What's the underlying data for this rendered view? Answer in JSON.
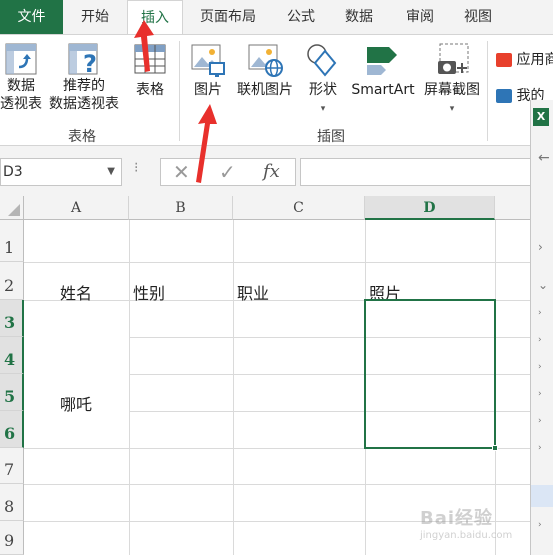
{
  "ribbon_tabs": {
    "file": "文件",
    "home": "开始",
    "insert": "插入",
    "page_layout": "页面布局",
    "formulas": "公式",
    "data": "数据",
    "review": "审阅",
    "view": "视图",
    "active": "插入"
  },
  "ribbon": {
    "tables_group": {
      "pivot_table": [
        "数据",
        "透视表"
      ],
      "recommended_pivot": [
        "推荐的",
        "数据透视表"
      ],
      "table": "表格",
      "label": "表格"
    },
    "illustrations_group": {
      "pictures": "图片",
      "online_pictures": "联机图片",
      "shapes": "形状",
      "smartart": "SmartArt",
      "screenshot": "屏幕截图",
      "label": "插图"
    },
    "addins_group": {
      "store": "应用商",
      "my_apps": "我的"
    }
  },
  "formula_bar": {
    "name_box": "D3",
    "fx": "fx",
    "value": ""
  },
  "sheet": {
    "columns": [
      "A",
      "B",
      "C",
      "D"
    ],
    "rows": [
      "1",
      "2",
      "3",
      "4",
      "5",
      "6",
      "7",
      "8",
      "9"
    ],
    "selected_cell": "D3",
    "cells": {
      "A2": "姓名",
      "B2": "性别",
      "C2": "职业",
      "D2": "照片",
      "A5": "哪吒"
    }
  },
  "side_pane": {
    "app_icon": "X"
  },
  "watermark": {
    "brand": "Bai经验",
    "site": "jingyan.baidu.com"
  },
  "colors": {
    "excel_green": "#217346",
    "annotation_red": "#e8302c"
  }
}
